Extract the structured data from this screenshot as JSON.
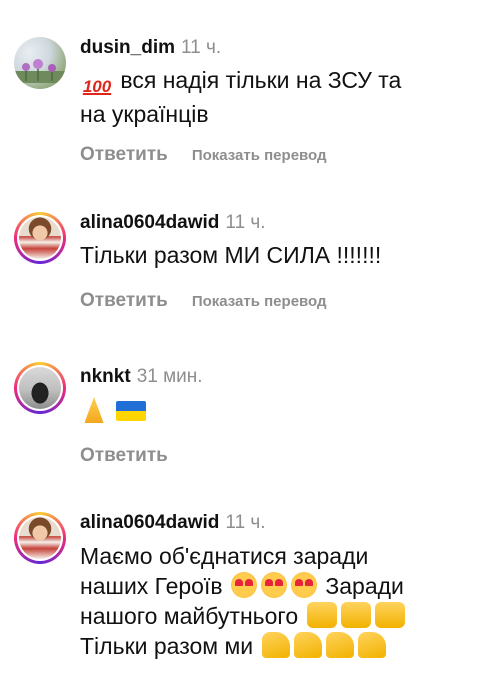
{
  "comments": [
    {
      "username": "dusin_dim",
      "time": "11 ч.",
      "text_line1": "вся надія тільки на ЗСУ та",
      "text_line2": "на українців",
      "emoji_lead": "100",
      "reply": "Ответить",
      "translate": "Показать перевод"
    },
    {
      "username": "alina0604dawid",
      "time": "11 ч.",
      "text": "Тільки разом МИ СИЛА !!!!!!!",
      "reply": "Ответить",
      "translate": "Показать перевод"
    },
    {
      "username": "nknkt",
      "time": "31 мин.",
      "reply": "Ответить"
    },
    {
      "username": "alina0604dawid",
      "time": "11 ч.",
      "line1": "Маємо об'єднатися заради",
      "line2a": "наших Героїв",
      "line2b": "Заради",
      "line3": "нашого майбутнього",
      "line4": "Тільки разом ми"
    }
  ],
  "icons": {
    "c1_lead": "hundred-points-emoji",
    "c3_1": "folded-hands-emoji",
    "c3_2": "ukraine-flag-emoji",
    "heart_eyes": "smiling-face-with-heart-eyes-emoji",
    "raised_hands": "raising-hands-emoji",
    "muscle": "flexed-biceps-emoji"
  },
  "colors": {
    "text": "#111111",
    "muted": "#8e8e8e",
    "story_ring_start": "#f9ce34",
    "story_ring_mid": "#ee2a7b",
    "story_ring_end": "#6228d7"
  }
}
